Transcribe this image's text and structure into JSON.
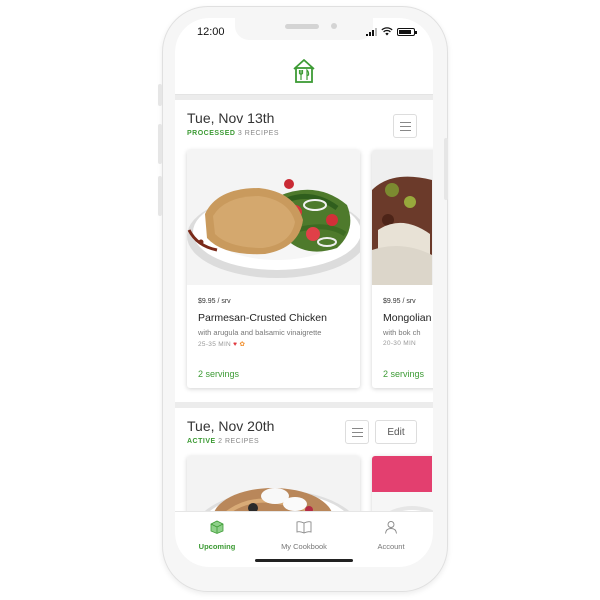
{
  "status_bar": {
    "time": "12:00"
  },
  "weeks": [
    {
      "date": "Tue, Nov 13th",
      "status": "PROCESSED",
      "count": "3 RECIPES",
      "recipes": [
        {
          "price": "$9.95 / srv",
          "title": "Parmesan-Crusted Chicken",
          "subtitle": "with arugula and balsamic vinaigrette",
          "time": "25-35 MIN",
          "servings": "2 servings"
        },
        {
          "price": "$9.95 / srv",
          "title": "Mongolian",
          "subtitle": "with bok ch",
          "time": "20-30 MIN",
          "servings": "2 servings"
        }
      ]
    },
    {
      "date": "Tue, Nov 20th",
      "status": "ACTIVE",
      "count": "2 RECIPES",
      "edit_label": "Edit"
    }
  ],
  "tabs": [
    {
      "label": "Upcoming",
      "active": true
    },
    {
      "label": "My Cookbook",
      "active": false
    },
    {
      "label": "Account",
      "active": false
    }
  ],
  "colors": {
    "accent": "#3d9b35",
    "text": "#333333",
    "muted": "#999999",
    "background": "#ececec"
  }
}
